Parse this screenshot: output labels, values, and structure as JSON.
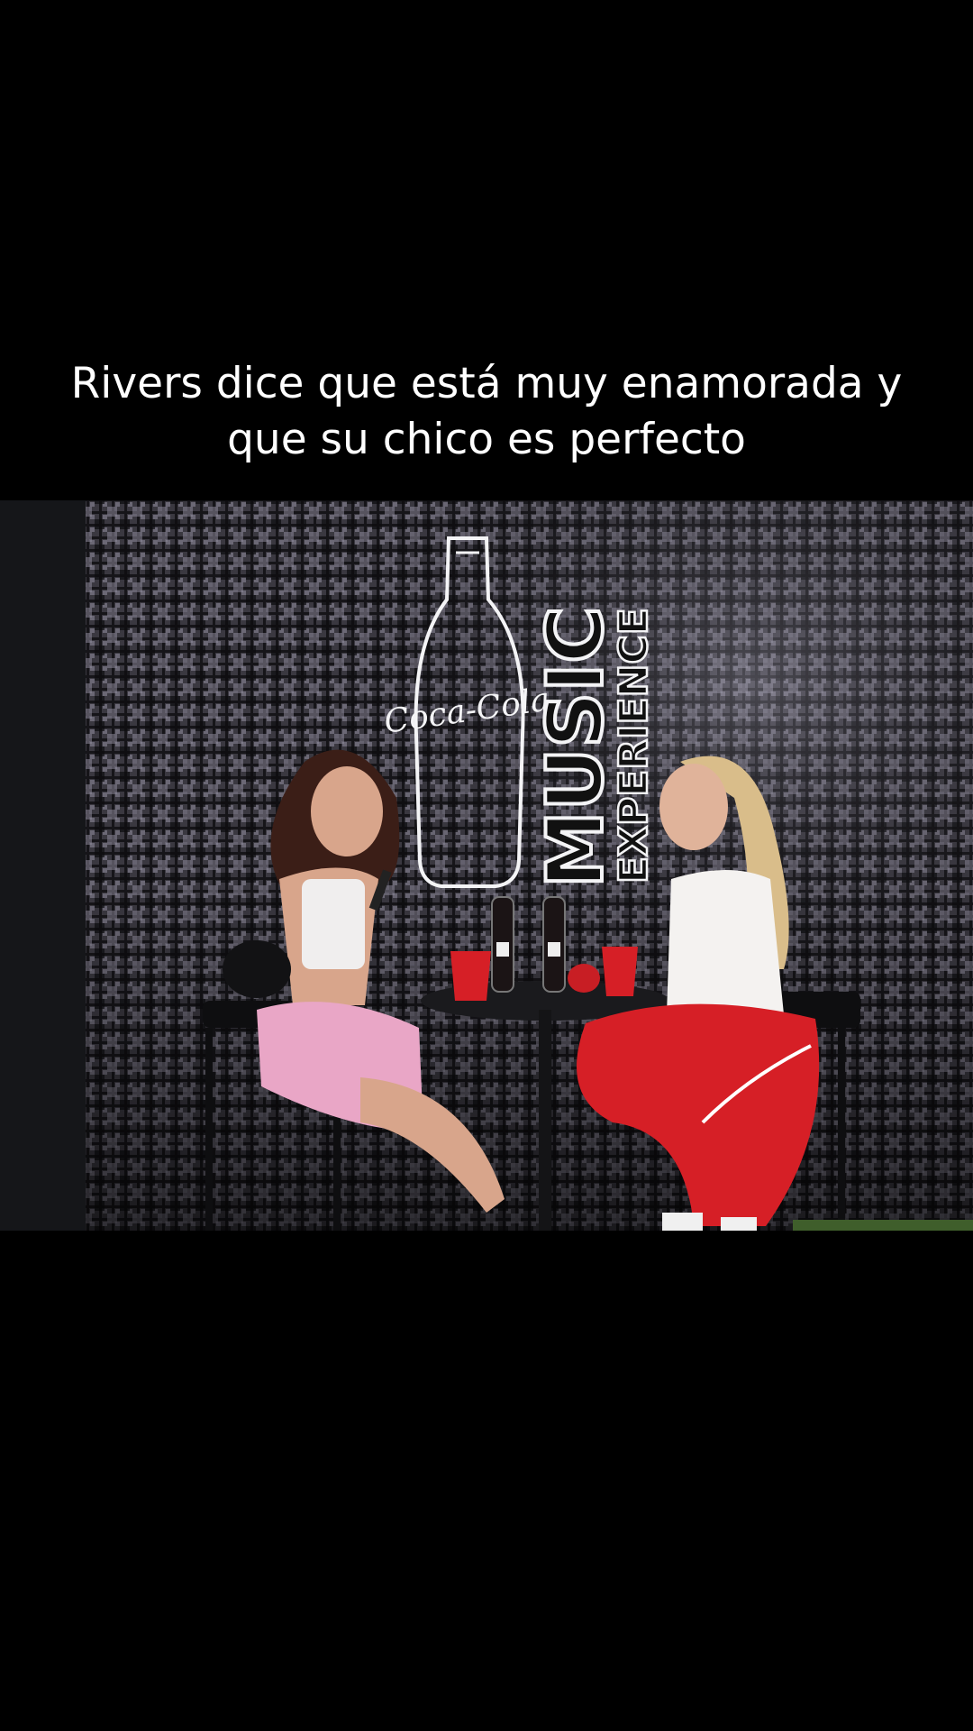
{
  "caption": {
    "line1": "Rivers dice que está muy enamorada y",
    "line2": "que su chico es perfecto"
  },
  "scene": {
    "neon_brand": "Coca-Cola",
    "neon_word_main": "MUSIC",
    "neon_word_sub": "EXPERIENCE"
  },
  "colors": {
    "background": "#000000",
    "caption_text": "#ffffff",
    "neon": "#f4f4f6",
    "pants_red": "#d61f26",
    "skirt_pink": "#e9a6c6"
  }
}
